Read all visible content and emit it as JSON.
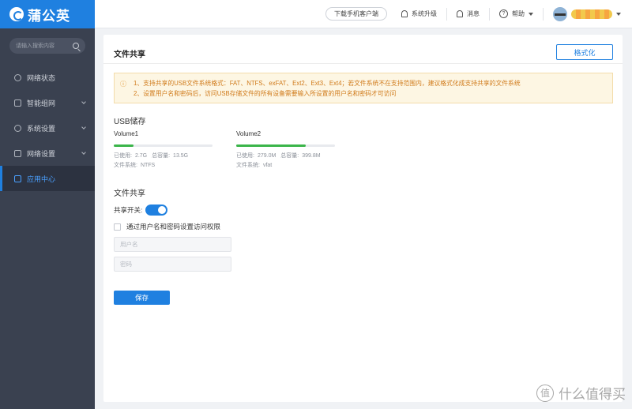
{
  "app": {
    "brand": "蒲公英"
  },
  "sidebar": {
    "search_placeholder": "请输入搜索内容",
    "items": [
      {
        "label": "网络状态",
        "icon": "network-status-icon"
      },
      {
        "label": "智能组网",
        "icon": "smart-network-icon"
      },
      {
        "label": "系统设置",
        "icon": "gear-icon"
      },
      {
        "label": "网络设置",
        "icon": "network-settings-icon"
      },
      {
        "label": "应用中心",
        "icon": "app-center-icon",
        "active": true
      }
    ]
  },
  "topbar": {
    "download_label": "下载手机客户端",
    "upgrade_label": "系统升级",
    "messages_label": "消息",
    "help_label": "帮助"
  },
  "main": {
    "title": "文件共享",
    "format_button": "格式化",
    "notice": [
      "1、支持共享的USB文件系统格式：FAT、NTFS、exFAT、Ext2、Ext3、Ext4；若文件系统不在支持范围内，建议格式化成支持共享的文件系统",
      "2、设置用户名和密码后，访问USB存储文件的所有设备需要输入所设置的用户名和密码才可访问"
    ],
    "usb_heading": "USB储存",
    "volumes": [
      {
        "name": "Volume1",
        "used_label": "已使用:",
        "used": "2.7G",
        "total_label": "总容量:",
        "total": "13.5G",
        "fs_label": "文件系统:",
        "fs": "NTFS",
        "usage_fraction": 0.2
      },
      {
        "name": "Volume2",
        "used_label": "已使用:",
        "used": "279.0M",
        "total_label": "总容量:",
        "total": "399.8M",
        "fs_label": "文件系统:",
        "fs": "vfat",
        "usage_fraction": 0.7
      }
    ],
    "share_heading": "文件共享",
    "share_switch_label": "共享开关:",
    "share_switch_on": true,
    "auth_checkbox_label": "通过用户名和密码设置访问权限",
    "username_placeholder": "用户名",
    "password_placeholder": "密码",
    "save_button": "保存"
  },
  "watermark": {
    "badge": "值",
    "text": "什么值得买"
  },
  "colors": {
    "primary": "#1f80e0",
    "sidebar_bg": "#3a4150",
    "success": "#3bb54a",
    "notice_text": "#d07a1a"
  }
}
